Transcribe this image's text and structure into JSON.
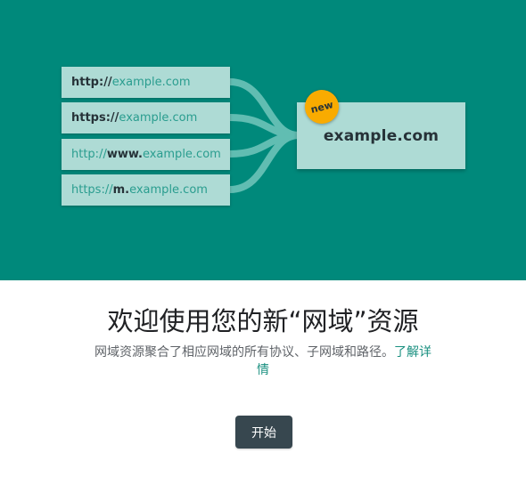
{
  "hero": {
    "sources": [
      {
        "parts": [
          {
            "text": "http://",
            "style": "strong"
          },
          {
            "text": "example.com",
            "style": "teal"
          }
        ]
      },
      {
        "parts": [
          {
            "text": "https://",
            "style": "strong"
          },
          {
            "text": "example.com",
            "style": "teal"
          }
        ]
      },
      {
        "parts": [
          {
            "text": "http://",
            "style": "teal"
          },
          {
            "text": "www.",
            "style": "strong"
          },
          {
            "text": "example.com",
            "style": "teal"
          }
        ]
      },
      {
        "parts": [
          {
            "text": "https://",
            "style": "teal"
          },
          {
            "text": "m.",
            "style": "strong"
          },
          {
            "text": "example.com",
            "style": "teal"
          }
        ]
      }
    ],
    "target": "example.com",
    "badge": "new"
  },
  "dialog": {
    "title": "欢迎使用您的新“网域”资源",
    "description": "网域资源聚合了相应网域的所有协议、子网域和路径。",
    "learn_more": "了解详情",
    "start_button": "开始"
  },
  "colors": {
    "hero_background": "#00897b",
    "card_background": "#aedbd5",
    "badge": "#f9ab00",
    "button": "#37474f"
  }
}
